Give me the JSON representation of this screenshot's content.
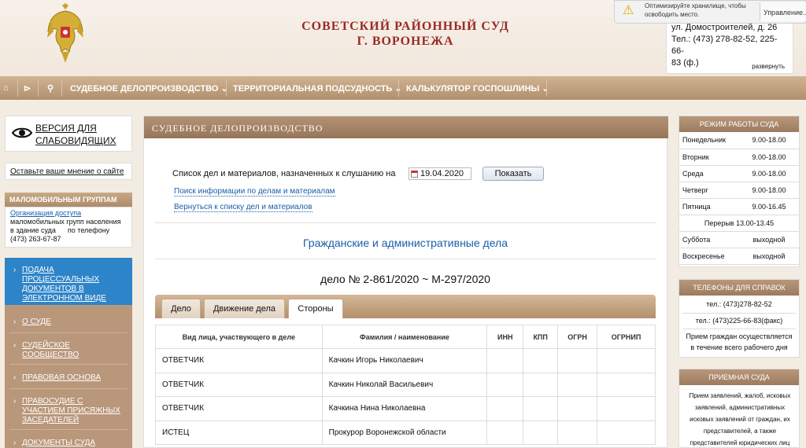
{
  "header": {
    "title_line1": "СОВЕТСКИЙ РАЙОННЫЙ СУД",
    "title_line2": "Г. ВОРОНЕЖА",
    "contact_line1": "ул. Домостроителей, д. 26",
    "contact_line2": "Тел.: (473) 278-82-52, 225-66-",
    "contact_line3": "83 (ф.)",
    "collapse_label": "развернуть",
    "notification_text": "Оптимизируйте хранилище, чтобы освободить место.",
    "notification_button": "Управление..."
  },
  "nav": {
    "items": [
      "СУДЕБНОЕ ДЕЛОПРОИЗВОДСТВО ⌄",
      "ТЕРРИТОРИАЛЬНАЯ ПОДСУДНОСТЬ ⌄",
      "КАЛЬКУЛЯТОР ГОСПОШЛИНЫ ⌄"
    ]
  },
  "left": {
    "vision_line1": "ВЕРСИЯ ДЛЯ",
    "vision_line2": "СЛАБОВИДЯЩИХ",
    "feedback": "Оставьте ваше мнение о сайте",
    "mobility_title": "МАЛОМОБИЛЬНЫМ ГРУППАМ",
    "mobility_link": "Организация доступа",
    "mobility_line2": "маломобильных групп населения",
    "mobility_line3": "в здание суда      по телефону",
    "mobility_line4": "(473) 263-67-87",
    "menu": [
      {
        "l1": "ПОДАЧА",
        "l2": "ПРОЦЕССУАЛЬНЫХ",
        "l3": "ДОКУМЕНТОВ В",
        "l4": "ЭЛЕКТРОННОМ ВИДЕ"
      },
      {
        "l1": "О СУДЕ"
      },
      {
        "l1": "СУДЕЙСКОЕ",
        "l2": "СООБЩЕСТВО"
      },
      {
        "l1": "ПРАВОВАЯ ОСНОВА"
      },
      {
        "l1": "ПРАВОСУДИЕ С",
        "l2": "УЧАСТИЕМ ПРИСЯЖНЫХ",
        "l3": "ЗАСЕДАТЕЛЕЙ"
      },
      {
        "l1": "ДОКУМЕНТЫ СУДА"
      }
    ]
  },
  "main": {
    "header": "СУДЕБНОЕ ДЕЛОПРОИЗВОДСТВО",
    "search_label": "Список дел и материалов, назначенных к слушанию на",
    "date_value": "19.04.2020",
    "show_button": "Показать",
    "link_search": "Поиск информации по делам и материалам",
    "link_back": "Вернуться к списку дел и материалов",
    "section_title": "Гражданские и административные дела",
    "case_number": "дело № 2-861/2020 ~ М-297/2020",
    "tabs": [
      "Дело",
      "Движение дела",
      "Стороны"
    ],
    "active_tab": "Стороны",
    "table_headers": [
      "Вид лица, участвующего в деле",
      "Фамилия / наименование",
      "ИНН",
      "КПП",
      "ОГРН",
      "ОГРНИП"
    ],
    "rows": [
      [
        "ОТВЕТЧИК",
        "Качкин Игорь Николаевич"
      ],
      [
        "ОТВЕТЧИК",
        "Качкин Николай Васильевич"
      ],
      [
        "ОТВЕТЧИК",
        "Качкина Нина Николаевна"
      ],
      [
        "ИСТЕЦ",
        "Прокурор Воронежской области"
      ]
    ]
  },
  "right": {
    "hours_title": "РЕЖИМ РАБОТЫ СУДА",
    "hours": [
      {
        "day": "Понедельник",
        "time": "9.00-18.00"
      },
      {
        "day": "Вторник",
        "time": "9.00-18.00"
      },
      {
        "day": "Среда",
        "time": "9.00-18.00"
      },
      {
        "day": "Четверг",
        "time": "9.00-18.00"
      },
      {
        "day": "Пятница",
        "time": "9.00-16.45"
      }
    ],
    "break": "Перерыв 13.00-13.45",
    "weekend": [
      {
        "day": "Суббота",
        "time": "выходной"
      },
      {
        "day": "Воскресенье",
        "time": "выходной"
      }
    ],
    "phones_title": "ТЕЛЕФОНЫ ДЛЯ СПРАВОК",
    "phone1": "тел.: (473)278-82-52",
    "phone2": "тел.: (473)225-66-83(факс)",
    "phones_note1": "Прием граждан осуществляется",
    "phones_note2": "в течение всего рабочего дня",
    "reception_title": "ПРИЕМНАЯ СУДА",
    "reception_text": "Прием заявлений, жалоб, исковых заявлений, административных исковых заявлений от граждан, их представителей, а также представителей юридических лиц"
  },
  "colors": {
    "title_red": "#9a2a24",
    "nav_brown": "#b28f6d",
    "link_blue": "#1a5ea8",
    "active_menu_blue": "#2e84c8"
  }
}
